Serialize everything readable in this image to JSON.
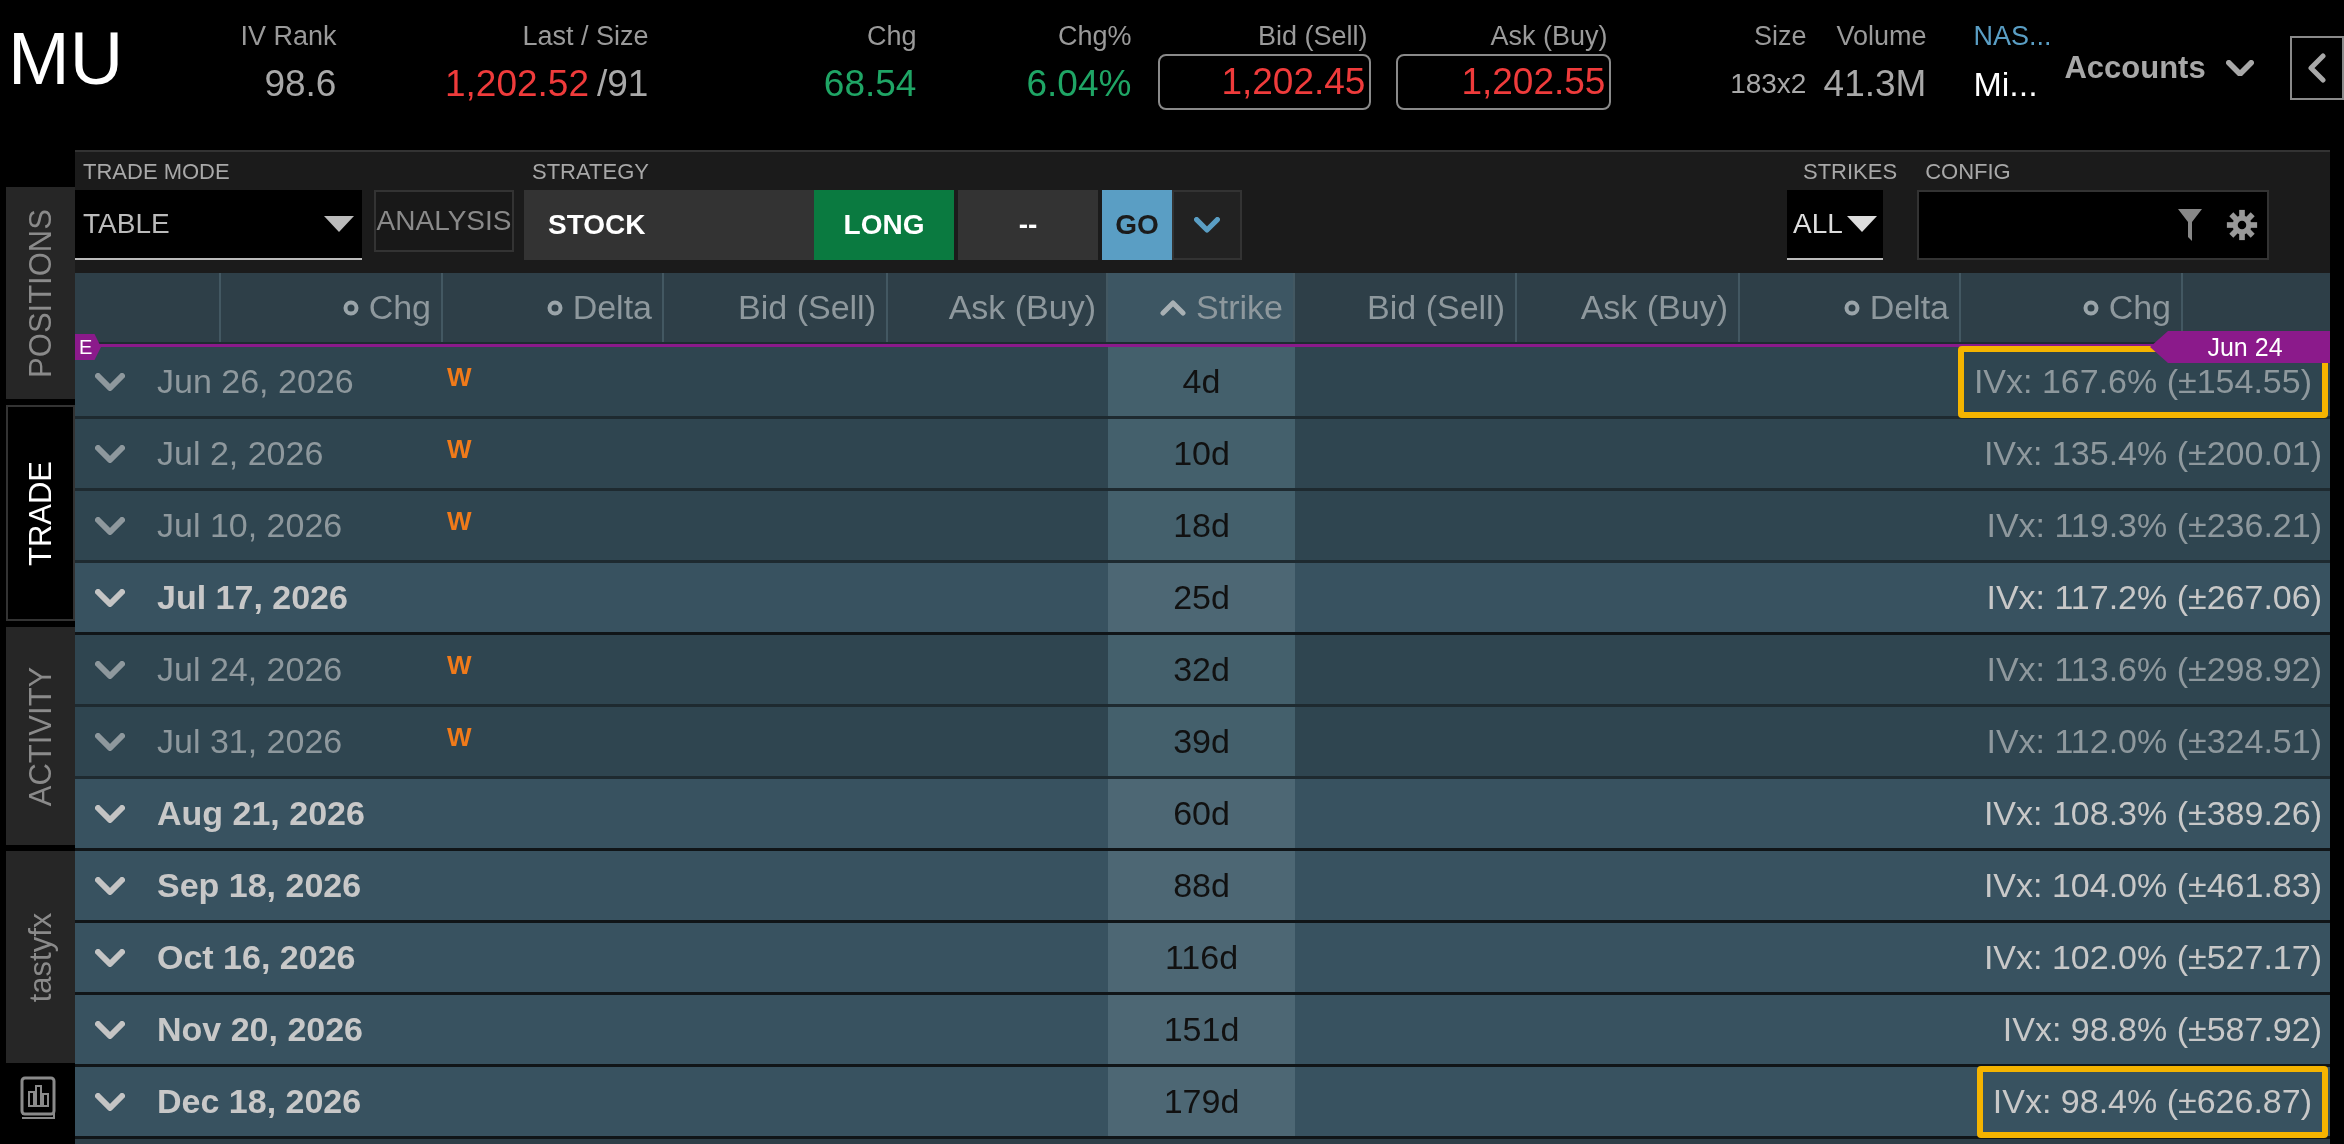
{
  "symbol": "MU",
  "quote_fields": [
    {
      "label": "IV Rank",
      "kind": "plain",
      "value": "98.6"
    },
    {
      "label": "Last / Size",
      "kind": "last",
      "value": "1,202.52",
      "size": "/91"
    },
    {
      "label": "Chg",
      "kind": "up",
      "value": "68.54"
    },
    {
      "label": "Chg%",
      "kind": "up",
      "value": "6.04%"
    },
    {
      "label": "Bid (Sell)",
      "kind": "boxed",
      "value": "1,202.45"
    },
    {
      "label": "Ask (Buy)",
      "kind": "boxed",
      "value": "1,202.55"
    },
    {
      "label": "Size",
      "kind": "small",
      "value": "183x2"
    },
    {
      "label": "Volume",
      "kind": "plain",
      "value": "41.3M"
    },
    {
      "label": "NAS...",
      "kind": "exchange",
      "value": "Mi..."
    }
  ],
  "accounts_button": "Accounts",
  "side_tabs": [
    {
      "label": "POSITIONS",
      "selected": false
    },
    {
      "label": "TRADE",
      "selected": true
    },
    {
      "label": "ACTIVITY",
      "selected": false
    },
    {
      "label": "tastyfx",
      "selected": false
    }
  ],
  "toolbar": {
    "trade_mode": {
      "label": "TRADE MODE",
      "value": "TABLE"
    },
    "analysis_button": "ANALYSIS",
    "strategy": {
      "label": "STRATEGY",
      "value": "STOCK",
      "side": "LONG",
      "option": "--",
      "go": "GO"
    },
    "strikes": {
      "label": "STRIKES",
      "value": "ALL"
    },
    "config": {
      "label": "CONFIG"
    }
  },
  "table": {
    "columns": [
      {
        "label": "Chg",
        "kind": "toggle"
      },
      {
        "label": "Delta",
        "kind": "toggle"
      },
      {
        "label": "Bid (Sell)",
        "kind": "plain"
      },
      {
        "label": "Ask (Buy)",
        "kind": "plain"
      },
      {
        "label": "Strike",
        "kind": "sorted"
      },
      {
        "label": "Bid (Sell)",
        "kind": "plain"
      },
      {
        "label": "Ask (Buy)",
        "kind": "plain"
      },
      {
        "label": "Delta",
        "kind": "toggle"
      },
      {
        "label": "Chg",
        "kind": "toggle"
      }
    ],
    "expiry_marker": "E",
    "today_tag": "Jun 24",
    "rows": [
      {
        "date": "Jun 26, 2026",
        "weekly": true,
        "flag": "W",
        "dte": "4d",
        "ivx": "IVx: 167.6% (±154.55)",
        "highlighted": true
      },
      {
        "date": "Jul 2, 2026",
        "weekly": true,
        "flag": "W",
        "dte": "10d",
        "ivx": "IVx: 135.4% (±200.01)",
        "highlighted": false
      },
      {
        "date": "Jul 10, 2026",
        "weekly": true,
        "flag": "W",
        "dte": "18d",
        "ivx": "IVx: 119.3% (±236.21)",
        "highlighted": false
      },
      {
        "date": "Jul 17, 2026",
        "weekly": false,
        "dte": "25d",
        "ivx": "IVx: 117.2% (±267.06)",
        "highlighted": false
      },
      {
        "date": "Jul 24, 2026",
        "weekly": true,
        "flag": "W",
        "dte": "32d",
        "ivx": "IVx: 113.6% (±298.92)",
        "highlighted": false
      },
      {
        "date": "Jul 31, 2026",
        "weekly": true,
        "flag": "W",
        "dte": "39d",
        "ivx": "IVx: 112.0% (±324.51)",
        "highlighted": false
      },
      {
        "date": "Aug 21, 2026",
        "weekly": false,
        "dte": "60d",
        "ivx": "IVx: 108.3% (±389.26)",
        "highlighted": false
      },
      {
        "date": "Sep 18, 2026",
        "weekly": false,
        "dte": "88d",
        "ivx": "IVx: 104.0% (±461.83)",
        "highlighted": false
      },
      {
        "date": "Oct 16, 2026",
        "weekly": false,
        "dte": "116d",
        "ivx": "IVx: 102.0% (±527.17)",
        "highlighted": false
      },
      {
        "date": "Nov 20, 2026",
        "weekly": false,
        "dte": "151d",
        "ivx": "IVx: 98.8% (±587.92)",
        "highlighted": false
      },
      {
        "date": "Dec 18, 2026",
        "weekly": false,
        "dte": "179d",
        "ivx": "IVx: 98.4% (±626.87)",
        "highlighted": true
      }
    ]
  }
}
